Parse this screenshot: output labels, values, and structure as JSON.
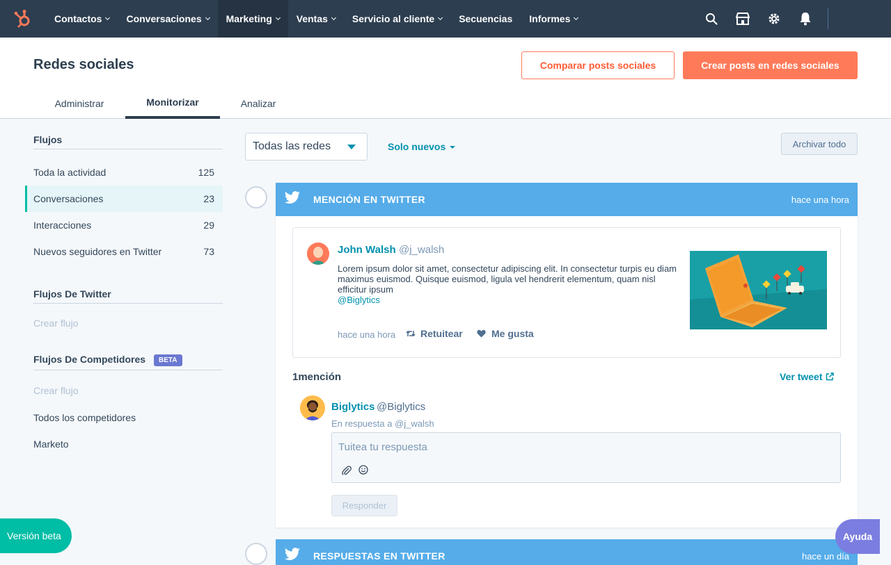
{
  "topnav": {
    "items": [
      {
        "label": "Contactos",
        "has_caret": true
      },
      {
        "label": "Conversaciones",
        "has_caret": true
      },
      {
        "label": "Marketing",
        "has_caret": true,
        "active": true
      },
      {
        "label": "Ventas",
        "has_caret": true
      },
      {
        "label": "Servicio al cliente",
        "has_caret": true
      },
      {
        "label": "Secuencias",
        "has_caret": false
      },
      {
        "label": "Informes",
        "has_caret": true
      }
    ],
    "icons": [
      "search-icon",
      "marketplace-icon",
      "gear-icon",
      "bell-icon"
    ]
  },
  "header": {
    "title": "Redes sociales",
    "compare_button": "Comparar posts sociales",
    "create_button": "Crear posts en redes sociales",
    "tabs": [
      "Administrar",
      "Monitorizar",
      "Analizar"
    ],
    "active_tab": "Monitorizar"
  },
  "sidebar": {
    "streams_heading": "Flujos",
    "streams": [
      {
        "label": "Toda la actividad",
        "count": "125"
      },
      {
        "label": "Conversaciones",
        "count": "23"
      },
      {
        "label": "Interacciones",
        "count": "29"
      },
      {
        "label": "Nuevos seguidores en Twitter",
        "count": "73"
      }
    ],
    "twitter_heading": "Flujos De Twitter",
    "twitter_create": "Crear flujo",
    "competitors_heading": "Flujos De Competidores",
    "competitors_badge": "BETA",
    "competitors_create": "Crear flujo",
    "competitors_items": [
      "Todos los competidores",
      "Marketo"
    ]
  },
  "filters": {
    "network": "Todas las redes",
    "only_new": "Solo nuevos",
    "archive_all": "Archivar todo"
  },
  "card1": {
    "type": "MENCIÓN EN TWITTER",
    "time": "hace una hora",
    "tweet": {
      "name": "John Walsh",
      "handle": "@j_walsh",
      "body": "Lorem ipsum dolor sit amet, consectetur adipiscing elit. In consectetur turpis eu diam maximus euismod. Quisque euismod, ligula vel hendrerit elementum, quam nisl efficitur ipsum",
      "mention": "@Biglytics",
      "time": "hace una hora",
      "retweet": "Retuitear",
      "like": "Me gusta"
    },
    "mentions": "1mención",
    "view_tweet": "Ver tweet",
    "reply": {
      "name": "Biglytics",
      "handle": "@Biglytics",
      "in_reply": "En respuesta a @j_walsh",
      "placeholder": "Tuitea tu respuesta",
      "button": "Responder"
    }
  },
  "card2": {
    "type": "RESPUESTAS EN TWITTER",
    "time": "hace un día"
  },
  "floating": {
    "beta": "Versión beta",
    "help": "Ayuda"
  },
  "colors": {
    "nav_bg": "#2d3e50",
    "accent_orange": "#ff7a59",
    "twitter_blue": "#55ace9",
    "link_teal": "#0091ae",
    "beta_green": "#00bda5",
    "help_purple": "#7b7ee0"
  }
}
